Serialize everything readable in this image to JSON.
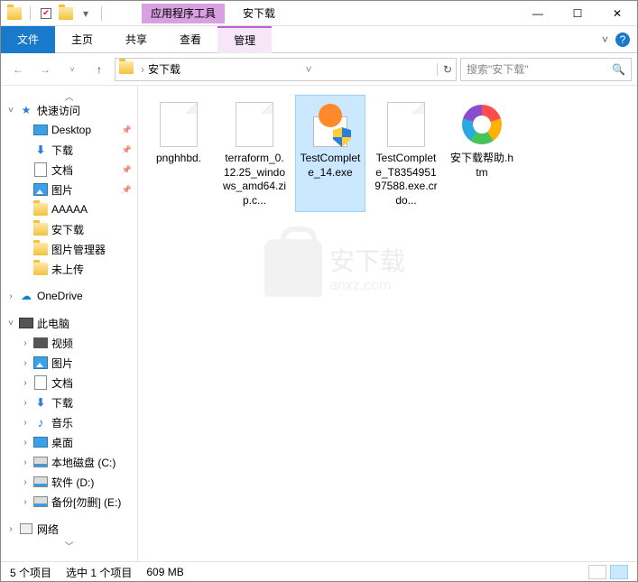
{
  "titlebar": {
    "context_tab_label": "应用程序工具",
    "title": "安下载"
  },
  "win_controls": {
    "min": "—",
    "max": "☐",
    "close": "✕"
  },
  "ribbon": {
    "file": "文件",
    "home": "主页",
    "share": "共享",
    "view": "查看",
    "manage": "管理",
    "expand": "˅",
    "help": "?"
  },
  "nav": {
    "back": "←",
    "forward": "→",
    "recent": "˅",
    "up": "↑",
    "root_sep": "›",
    "location": "安下载",
    "dropdown": "˅",
    "refresh": "↻"
  },
  "search": {
    "placeholder": "搜索\"安下载\"",
    "icon": "🔍"
  },
  "sidebar": {
    "quick_access": "快速访问",
    "items_qa": [
      {
        "icon": "desktop",
        "label": "Desktop"
      },
      {
        "icon": "download",
        "label": "下载"
      },
      {
        "icon": "doc",
        "label": "文档"
      },
      {
        "icon": "pic",
        "label": "图片"
      },
      {
        "icon": "folder",
        "label": "AAAAA"
      },
      {
        "icon": "folder",
        "label": "安下载"
      },
      {
        "icon": "folder",
        "label": "图片管理器"
      },
      {
        "icon": "folder",
        "label": "未上传"
      }
    ],
    "onedrive": "OneDrive",
    "this_pc": "此电脑",
    "items_pc": [
      {
        "icon": "video",
        "label": "视频"
      },
      {
        "icon": "pic",
        "label": "图片"
      },
      {
        "icon": "doc",
        "label": "文档"
      },
      {
        "icon": "download",
        "label": "下载"
      },
      {
        "icon": "music",
        "label": "音乐"
      },
      {
        "icon": "desktop",
        "label": "桌面"
      },
      {
        "icon": "disk",
        "label": "本地磁盘 (C:)"
      },
      {
        "icon": "disk",
        "label": "软件 (D:)"
      },
      {
        "icon": "disk",
        "label": "备份[勿删] (E:)"
      }
    ],
    "network": "网络"
  },
  "files": [
    {
      "name": "pnghhbd.",
      "type": "blank",
      "selected": false
    },
    {
      "name": "terraform_0.12.25_windows_amd64.zip.c...",
      "type": "blank",
      "selected": false
    },
    {
      "name": "TestComplete_14.exe",
      "type": "exe",
      "selected": true
    },
    {
      "name": "TestComplete_T835495197588.exe.crdo...",
      "type": "blank",
      "selected": false
    },
    {
      "name": "安下载帮助.htm",
      "type": "htm",
      "selected": false
    }
  ],
  "watermark": {
    "text": "安下载",
    "sub": "anxz.com"
  },
  "status": {
    "count": "5 个项目",
    "selection": "选中 1 个项目",
    "size": "609 MB"
  }
}
